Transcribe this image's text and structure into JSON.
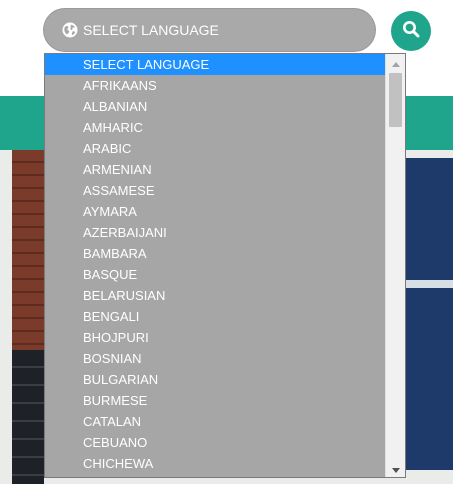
{
  "selector": {
    "label": "SELECT LANGUAGE",
    "icon": "globe-icon"
  },
  "search_button": {
    "icon": "search-icon"
  },
  "dropdown": {
    "selected_index": 0,
    "options": [
      "SELECT LANGUAGE",
      "AFRIKAANS",
      "ALBANIAN",
      "AMHARIC",
      "ARABIC",
      "ARMENIAN",
      "ASSAMESE",
      "AYMARA",
      "AZERBAIJANI",
      "BAMBARA",
      "BASQUE",
      "BELARUSIAN",
      "BENGALI",
      "BHOJPURI",
      "BOSNIAN",
      "BULGARIAN",
      "BURMESE",
      "CATALAN",
      "CEBUANO",
      "CHICHEWA"
    ]
  },
  "colors": {
    "accent": "#1fa58c",
    "selector_bg": "#a9a9a9",
    "list_bg": "#a6a6a6",
    "selected_bg": "#1e90ff",
    "text": "#ffffff"
  }
}
